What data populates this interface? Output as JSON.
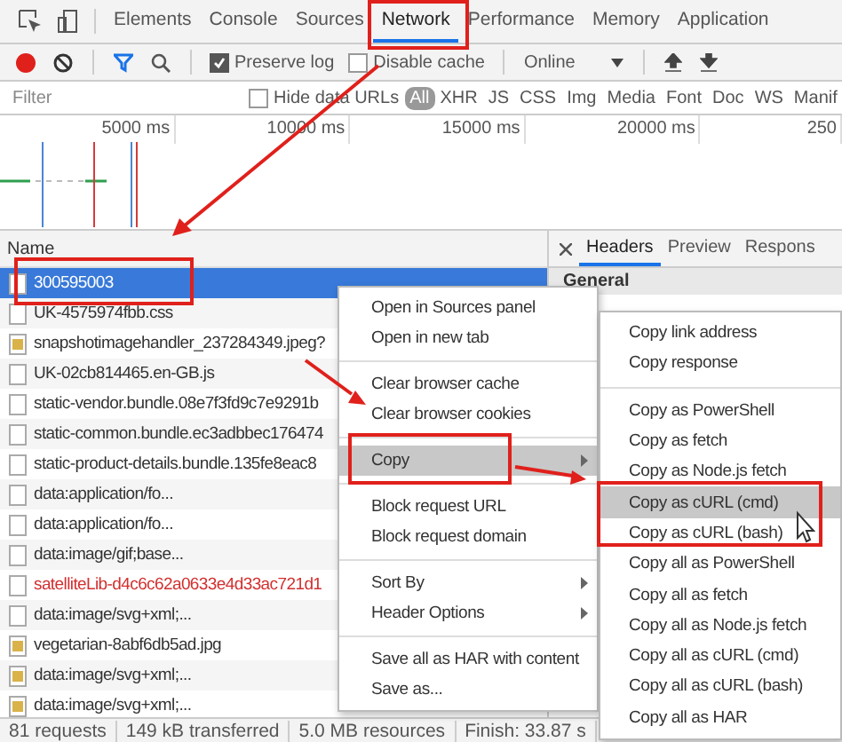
{
  "tabs": [
    {
      "label": "Elements",
      "selected": false
    },
    {
      "label": "Console",
      "selected": false
    },
    {
      "label": "Sources",
      "selected": false
    },
    {
      "label": "Network",
      "selected": true
    },
    {
      "label": "Performance",
      "selected": false
    },
    {
      "label": "Memory",
      "selected": false
    },
    {
      "label": "Application",
      "selected": false
    }
  ],
  "toolbar": {
    "preserve_log": {
      "label": "Preserve log",
      "checked": true
    },
    "disable_cache": {
      "label": "Disable cache",
      "checked": false
    },
    "throttling": "Online"
  },
  "filter": {
    "placeholder": "Filter",
    "hide_data_urls": {
      "label": "Hide data URLs",
      "checked": false
    },
    "types": [
      {
        "label": "All",
        "selected": true
      },
      {
        "label": "XHR",
        "selected": false
      },
      {
        "label": "JS",
        "selected": false
      },
      {
        "label": "CSS",
        "selected": false
      },
      {
        "label": "Img",
        "selected": false
      },
      {
        "label": "Media",
        "selected": false
      },
      {
        "label": "Font",
        "selected": false
      },
      {
        "label": "Doc",
        "selected": false
      },
      {
        "label": "WS",
        "selected": false
      },
      {
        "label": "Manif",
        "selected": false
      }
    ]
  },
  "overview": {
    "ticks": [
      "5000 ms",
      "10000 ms",
      "15000 ms",
      "20000 ms",
      "250"
    ]
  },
  "requests": {
    "column": "Name",
    "rows": [
      {
        "name": "300595003",
        "kind": "file",
        "selected": true,
        "failed": false
      },
      {
        "name": "UK-4575974fbb.css",
        "kind": "file",
        "selected": false,
        "failed": false
      },
      {
        "name": "snapshotimagehandler_237284349.jpeg?",
        "kind": "image",
        "selected": false,
        "failed": false
      },
      {
        "name": "UK-02cb814465.en-GB.js",
        "kind": "file",
        "selected": false,
        "failed": false
      },
      {
        "name": "static-vendor.bundle.08e7f3fd9c7e9291b",
        "kind": "file",
        "selected": false,
        "failed": false
      },
      {
        "name": "static-common.bundle.ec3adbbec176474",
        "kind": "file",
        "selected": false,
        "failed": false
      },
      {
        "name": "static-product-details.bundle.135fe8eac8",
        "kind": "file",
        "selected": false,
        "failed": false
      },
      {
        "name": "data:application/fo...",
        "kind": "file",
        "selected": false,
        "failed": false
      },
      {
        "name": "data:application/fo...",
        "kind": "file",
        "selected": false,
        "failed": false
      },
      {
        "name": "data:image/gif;base...",
        "kind": "file",
        "selected": false,
        "failed": false
      },
      {
        "name": "satelliteLib-d4c6c62a0633e4d33ac721d1",
        "kind": "file",
        "selected": false,
        "failed": true
      },
      {
        "name": "data:image/svg+xml;...",
        "kind": "file",
        "selected": false,
        "failed": false
      },
      {
        "name": "vegetarian-8abf6db5ad.jpg",
        "kind": "image",
        "selected": false,
        "failed": false
      },
      {
        "name": "data:image/svg+xml;...",
        "kind": "image",
        "selected": false,
        "failed": false
      },
      {
        "name": "data:image/svg+xml;...",
        "kind": "image",
        "selected": false,
        "failed": false
      }
    ]
  },
  "details": {
    "tabs": [
      {
        "label": "Headers",
        "selected": true
      },
      {
        "label": "Preview",
        "selected": false
      },
      {
        "label": "Respons",
        "selected": false
      }
    ],
    "section": "General"
  },
  "status_bar": [
    "81 requests",
    "149 kB transferred",
    "5.0 MB resources",
    "Finish: 33.87 s"
  ],
  "context_menu": {
    "groups": [
      [
        {
          "label": "Open in Sources panel",
          "highlighted": false,
          "submenu": false
        },
        {
          "label": "Open in new tab",
          "highlighted": false,
          "submenu": false
        }
      ],
      [
        {
          "label": "Clear browser cache",
          "highlighted": false,
          "submenu": false
        },
        {
          "label": "Clear browser cookies",
          "highlighted": false,
          "submenu": false
        }
      ],
      [
        {
          "label": "Copy",
          "highlighted": true,
          "submenu": true
        }
      ],
      [
        {
          "label": "Block request URL",
          "highlighted": false,
          "submenu": false
        },
        {
          "label": "Block request domain",
          "highlighted": false,
          "submenu": false
        }
      ],
      [
        {
          "label": "Sort By",
          "highlighted": false,
          "submenu": true
        },
        {
          "label": "Header Options",
          "highlighted": false,
          "submenu": true
        }
      ],
      [
        {
          "label": "Save all as HAR with content",
          "highlighted": false,
          "submenu": false
        },
        {
          "label": "Save as...",
          "highlighted": false,
          "submenu": false
        }
      ]
    ]
  },
  "copy_submenu": {
    "groups": [
      [
        {
          "label": "Copy link address",
          "highlighted": false
        },
        {
          "label": "Copy response",
          "highlighted": false
        }
      ],
      [
        {
          "label": "Copy as PowerShell",
          "highlighted": false
        },
        {
          "label": "Copy as fetch",
          "highlighted": false
        },
        {
          "label": "Copy as Node.js fetch",
          "highlighted": false
        },
        {
          "label": "Copy as cURL (cmd)",
          "highlighted": true
        },
        {
          "label": "Copy as cURL (bash)",
          "highlighted": false
        },
        {
          "label": "Copy all as PowerShell",
          "highlighted": false
        },
        {
          "label": "Copy all as fetch",
          "highlighted": false
        },
        {
          "label": "Copy all as Node.js fetch",
          "highlighted": false
        },
        {
          "label": "Copy all as cURL (cmd)",
          "highlighted": false
        },
        {
          "label": "Copy all as cURL (bash)",
          "highlighted": false
        },
        {
          "label": "Copy all as HAR",
          "highlighted": false
        }
      ]
    ]
  }
}
